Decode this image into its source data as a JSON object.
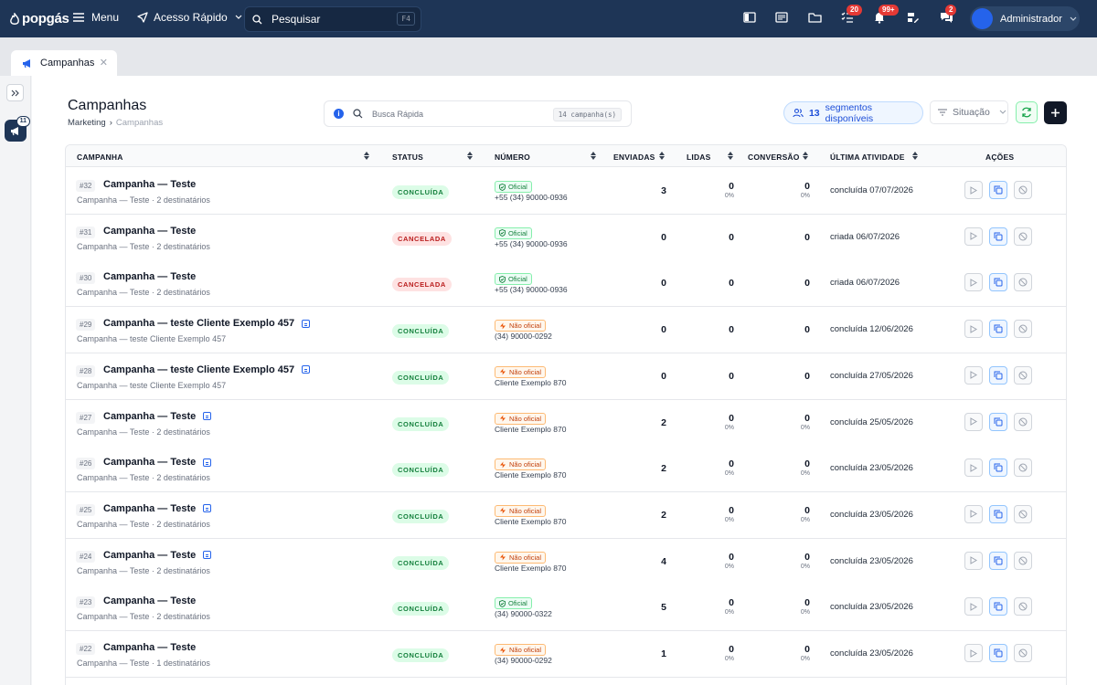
{
  "app": {
    "logo": "popgás"
  },
  "topbar": {
    "menu_label": "Menu",
    "quick_access_label": "Acesso Rápido",
    "search_placeholder": "Pesquisar",
    "search_shortcut": "F4",
    "badges": {
      "tasks": "20",
      "notifications": "99+",
      "chat": "2"
    },
    "user_name": "Administrador"
  },
  "tabs": [
    {
      "label": "Campanhas"
    }
  ],
  "rail": {
    "app_badge": "11"
  },
  "page": {
    "title": "Campanhas",
    "breadcrumb": [
      "Marketing",
      "Campanhas"
    ],
    "quick_search_placeholder": "Busca Rápida",
    "campaign_count_label": "14 campanha(s)",
    "segments_count": "13",
    "segments_label": "segmentos disponíveis",
    "situation_placeholder": "Situação"
  },
  "table": {
    "headers": [
      "CAMPANHA",
      "STATUS",
      "NÚMERO",
      "ENVIADAS",
      "LIDAS",
      "CONVERSÃO",
      "ÚLTIMA ATIVIDADE",
      "AÇÕES"
    ],
    "rows": [
      {
        "id": "#32",
        "name": "Campanha — Teste",
        "sub": "Campanha — Teste · 2 destinatários",
        "segment": false,
        "status": "CONCLUÍDA",
        "status_kind": "done",
        "number_type": "Oficial",
        "number_kind": "ofc",
        "number": "+55 (34) 90000-0936",
        "sent": "3",
        "read": "0",
        "read_pct": "0%",
        "conv": "0",
        "conv_pct": "0%",
        "activity": "concluída 07/07/2026"
      },
      {
        "id": "#31",
        "name": "Campanha — Teste",
        "sub": "Campanha — Teste · 2 destinatários",
        "segment": false,
        "status": "CANCELADA",
        "status_kind": "cancel",
        "number_type": "Oficial",
        "number_kind": "ofc",
        "number": "+55 (34) 90000-0936",
        "sent": "0",
        "read": "0",
        "read_pct": "",
        "conv": "0",
        "conv_pct": "",
        "activity": "criada 06/07/2026"
      },
      {
        "id": "#30",
        "name": "Campanha — Teste",
        "sub": "Campanha — Teste · 2 destinatários",
        "segment": false,
        "status": "CANCELADA",
        "status_kind": "cancel",
        "number_type": "Oficial",
        "number_kind": "ofc",
        "number": "+55 (34) 90000-0936",
        "sent": "0",
        "read": "0",
        "read_pct": "",
        "conv": "0",
        "conv_pct": "",
        "activity": "criada 06/07/2026"
      },
      {
        "id": "#29",
        "name": "Campanha — teste Cliente Exemplo 457",
        "sub": "Campanha — teste Cliente Exemplo 457",
        "segment": true,
        "status": "CONCLUÍDA",
        "status_kind": "done",
        "number_type": "Não oficial",
        "number_kind": "non",
        "number": "(34) 90000-0292",
        "sent": "0",
        "read": "0",
        "read_pct": "",
        "conv": "0",
        "conv_pct": "",
        "activity": "concluída 12/06/2026"
      },
      {
        "id": "#28",
        "name": "Campanha — teste Cliente Exemplo 457",
        "sub": "Campanha — teste Cliente Exemplo 457",
        "segment": true,
        "status": "CONCLUÍDA",
        "status_kind": "done",
        "number_type": "Não oficial",
        "number_kind": "non",
        "number": "Cliente Exemplo 870",
        "sent": "0",
        "read": "0",
        "read_pct": "",
        "conv": "0",
        "conv_pct": "",
        "activity": "concluída 27/05/2026"
      },
      {
        "id": "#27",
        "name": "Campanha — Teste",
        "sub": "Campanha — Teste · 2 destinatários",
        "segment": true,
        "status": "CONCLUÍDA",
        "status_kind": "done",
        "number_type": "Não oficial",
        "number_kind": "non",
        "number": "Cliente Exemplo 870",
        "sent": "2",
        "read": "0",
        "read_pct": "0%",
        "conv": "0",
        "conv_pct": "0%",
        "activity": "concluída 25/05/2026"
      },
      {
        "id": "#26",
        "name": "Campanha — Teste",
        "sub": "Campanha — Teste · 2 destinatários",
        "segment": true,
        "status": "CONCLUÍDA",
        "status_kind": "done",
        "number_type": "Não oficial",
        "number_kind": "non",
        "number": "Cliente Exemplo 870",
        "sent": "2",
        "read": "0",
        "read_pct": "0%",
        "conv": "0",
        "conv_pct": "0%",
        "activity": "concluída 23/05/2026"
      },
      {
        "id": "#25",
        "name": "Campanha — Teste",
        "sub": "Campanha — Teste · 2 destinatários",
        "segment": true,
        "status": "CONCLUÍDA",
        "status_kind": "done",
        "number_type": "Não oficial",
        "number_kind": "non",
        "number": "Cliente Exemplo 870",
        "sent": "2",
        "read": "0",
        "read_pct": "0%",
        "conv": "0",
        "conv_pct": "0%",
        "activity": "concluída 23/05/2026"
      },
      {
        "id": "#24",
        "name": "Campanha — Teste",
        "sub": "Campanha — Teste · 2 destinatários",
        "segment": true,
        "status": "CONCLUÍDA",
        "status_kind": "done",
        "number_type": "Não oficial",
        "number_kind": "non",
        "number": "Cliente Exemplo 870",
        "sent": "4",
        "read": "0",
        "read_pct": "0%",
        "conv": "0",
        "conv_pct": "0%",
        "activity": "concluída 23/05/2026"
      },
      {
        "id": "#23",
        "name": "Campanha — Teste",
        "sub": "Campanha — Teste · 2 destinatários",
        "segment": false,
        "status": "CONCLUÍDA",
        "status_kind": "done",
        "number_type": "Oficial",
        "number_kind": "ofc",
        "number": "(34) 90000-0322",
        "sent": "5",
        "read": "0",
        "read_pct": "0%",
        "conv": "0",
        "conv_pct": "0%",
        "activity": "concluída 23/05/2026"
      },
      {
        "id": "#22",
        "name": "Campanha — Teste",
        "sub": "Campanha — Teste · 1 destinatários",
        "segment": false,
        "status": "CONCLUÍDA",
        "status_kind": "done",
        "number_type": "Não oficial",
        "number_kind": "non",
        "number": "(34) 90000-0292",
        "sent": "1",
        "read": "0",
        "read_pct": "0%",
        "conv": "0",
        "conv_pct": "0%",
        "activity": "concluída 23/05/2026"
      }
    ]
  }
}
